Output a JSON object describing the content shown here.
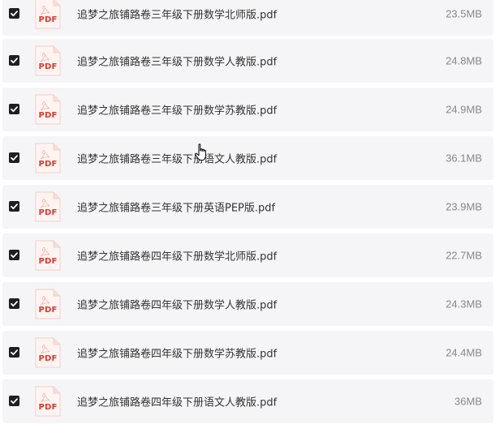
{
  "icons": {
    "checkbox": "checkbox-checked-icon",
    "file": "pdf-file-icon",
    "cursor": "hand-pointer-cursor-icon"
  },
  "colors": {
    "row_background": "#f5f5f7",
    "pdf_red": "#d63b2f",
    "checkbox": "#1f1f1f"
  },
  "files": [
    {
      "pdf_label": "PDF",
      "name": "追梦之旅铺路卷三年级下册数学北师版.pdf",
      "size": "23.5MB",
      "checked": true
    },
    {
      "pdf_label": "PDF",
      "name": "追梦之旅铺路卷三年级下册数学人教版.pdf",
      "size": "24.8MB",
      "checked": true
    },
    {
      "pdf_label": "PDF",
      "name": "追梦之旅铺路卷三年级下册数学苏教版.pdf",
      "size": "24.9MB",
      "checked": true
    },
    {
      "pdf_label": "PDF",
      "name": "追梦之旅铺路卷三年级下册语文人教版.pdf",
      "size": "36.1MB",
      "checked": true
    },
    {
      "pdf_label": "PDF",
      "name": "追梦之旅铺路卷三年级下册英语PEP版.pdf",
      "size": "23.9MB",
      "checked": true
    },
    {
      "pdf_label": "PDF",
      "name": "追梦之旅铺路卷四年级下册数学北师版.pdf",
      "size": "22.7MB",
      "checked": true
    },
    {
      "pdf_label": "PDF",
      "name": "追梦之旅铺路卷四年级下册数学人教版.pdf",
      "size": "24.3MB",
      "checked": true
    },
    {
      "pdf_label": "PDF",
      "name": "追梦之旅铺路卷四年级下册数学苏教版.pdf",
      "size": "24.4MB",
      "checked": true
    },
    {
      "pdf_label": "PDF",
      "name": "追梦之旅铺路卷四年级下册语文人教版.pdf",
      "size": "36MB",
      "checked": true
    }
  ]
}
